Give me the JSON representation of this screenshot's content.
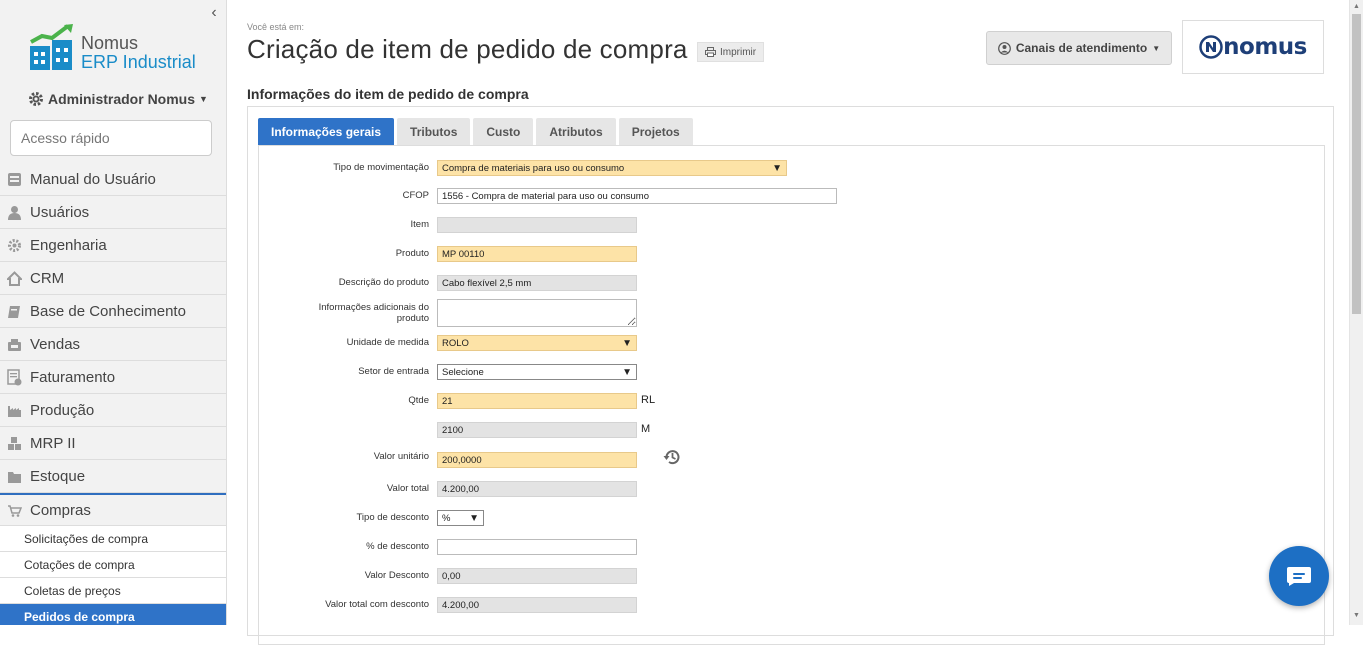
{
  "sidebar": {
    "logo_line1": "Nomus",
    "logo_line2": "ERP Industrial",
    "user_name": "Administrador Nomus",
    "quick_access_placeholder": "Acesso rápido",
    "menu": [
      {
        "label": "Manual do Usuário",
        "icon": "manual-icon"
      },
      {
        "label": "Usuários",
        "icon": "user-icon"
      },
      {
        "label": "Engenharia",
        "icon": "gear-icon"
      },
      {
        "label": "CRM",
        "icon": "home-icon"
      },
      {
        "label": "Base de Conhecimento",
        "icon": "book-icon"
      },
      {
        "label": "Vendas",
        "icon": "register-icon"
      },
      {
        "label": "Faturamento",
        "icon": "invoice-icon"
      },
      {
        "label": "Produção",
        "icon": "factory-icon"
      },
      {
        "label": "MRP II",
        "icon": "boxes-icon"
      },
      {
        "label": "Estoque",
        "icon": "folder-icon"
      },
      {
        "label": "Compras",
        "icon": "cart-icon"
      }
    ],
    "submenu": [
      {
        "label": "Solicitações de compra"
      },
      {
        "label": "Cotações de compra"
      },
      {
        "label": "Coletas de preços"
      },
      {
        "label": "Pedidos de compra"
      }
    ]
  },
  "header": {
    "breadcrumb_label": "Você está em:",
    "title": "Criação de item de pedido de compra",
    "print_label": "Imprimir",
    "channels_label": "Canais de atendimento",
    "brand": "nomus"
  },
  "section_title": "Informações do item de pedido de compra",
  "tabs": [
    {
      "label": "Informações gerais",
      "active": true
    },
    {
      "label": "Tributos"
    },
    {
      "label": "Custo"
    },
    {
      "label": "Atributos"
    },
    {
      "label": "Projetos"
    }
  ],
  "form": {
    "tipo_movimentacao": {
      "label": "Tipo de movimentação",
      "value": "Compra de materiais para uso ou consumo"
    },
    "cfop": {
      "label": "CFOP",
      "value": "1556 - Compra de material para uso ou consumo"
    },
    "item": {
      "label": "Item",
      "value": ""
    },
    "produto": {
      "label": "Produto",
      "value": "MP 00110"
    },
    "descricao": {
      "label": "Descrição do produto",
      "value": "Cabo flexível 2,5 mm"
    },
    "info_adicionais": {
      "label": "Informações adicionais do produto",
      "value": ""
    },
    "unidade_medida": {
      "label": "Unidade de medida",
      "value": "ROLO"
    },
    "setor_entrada": {
      "label": "Setor de entrada",
      "value": "Selecione"
    },
    "qtde": {
      "label": "Qtde",
      "value": "21",
      "unit": "RL"
    },
    "qtde_conv": {
      "value": "2100",
      "unit": "M"
    },
    "valor_unitario": {
      "label": "Valor unitário",
      "value": "200,0000"
    },
    "valor_total": {
      "label": "Valor total",
      "value": "4.200,00"
    },
    "tipo_desconto": {
      "label": "Tipo de desconto",
      "value": "%"
    },
    "perc_desconto": {
      "label": "% de desconto",
      "value": ""
    },
    "valor_desconto": {
      "label": "Valor Desconto",
      "value": "0,00"
    },
    "valor_total_desconto": {
      "label": "Valor total com desconto",
      "value": "4.200,00"
    }
  },
  "colors": {
    "primary": "#2f73c8",
    "required_field": "#fde3a7",
    "readonly_field": "#e3e3e3",
    "brand_blue": "#1e3f78"
  }
}
